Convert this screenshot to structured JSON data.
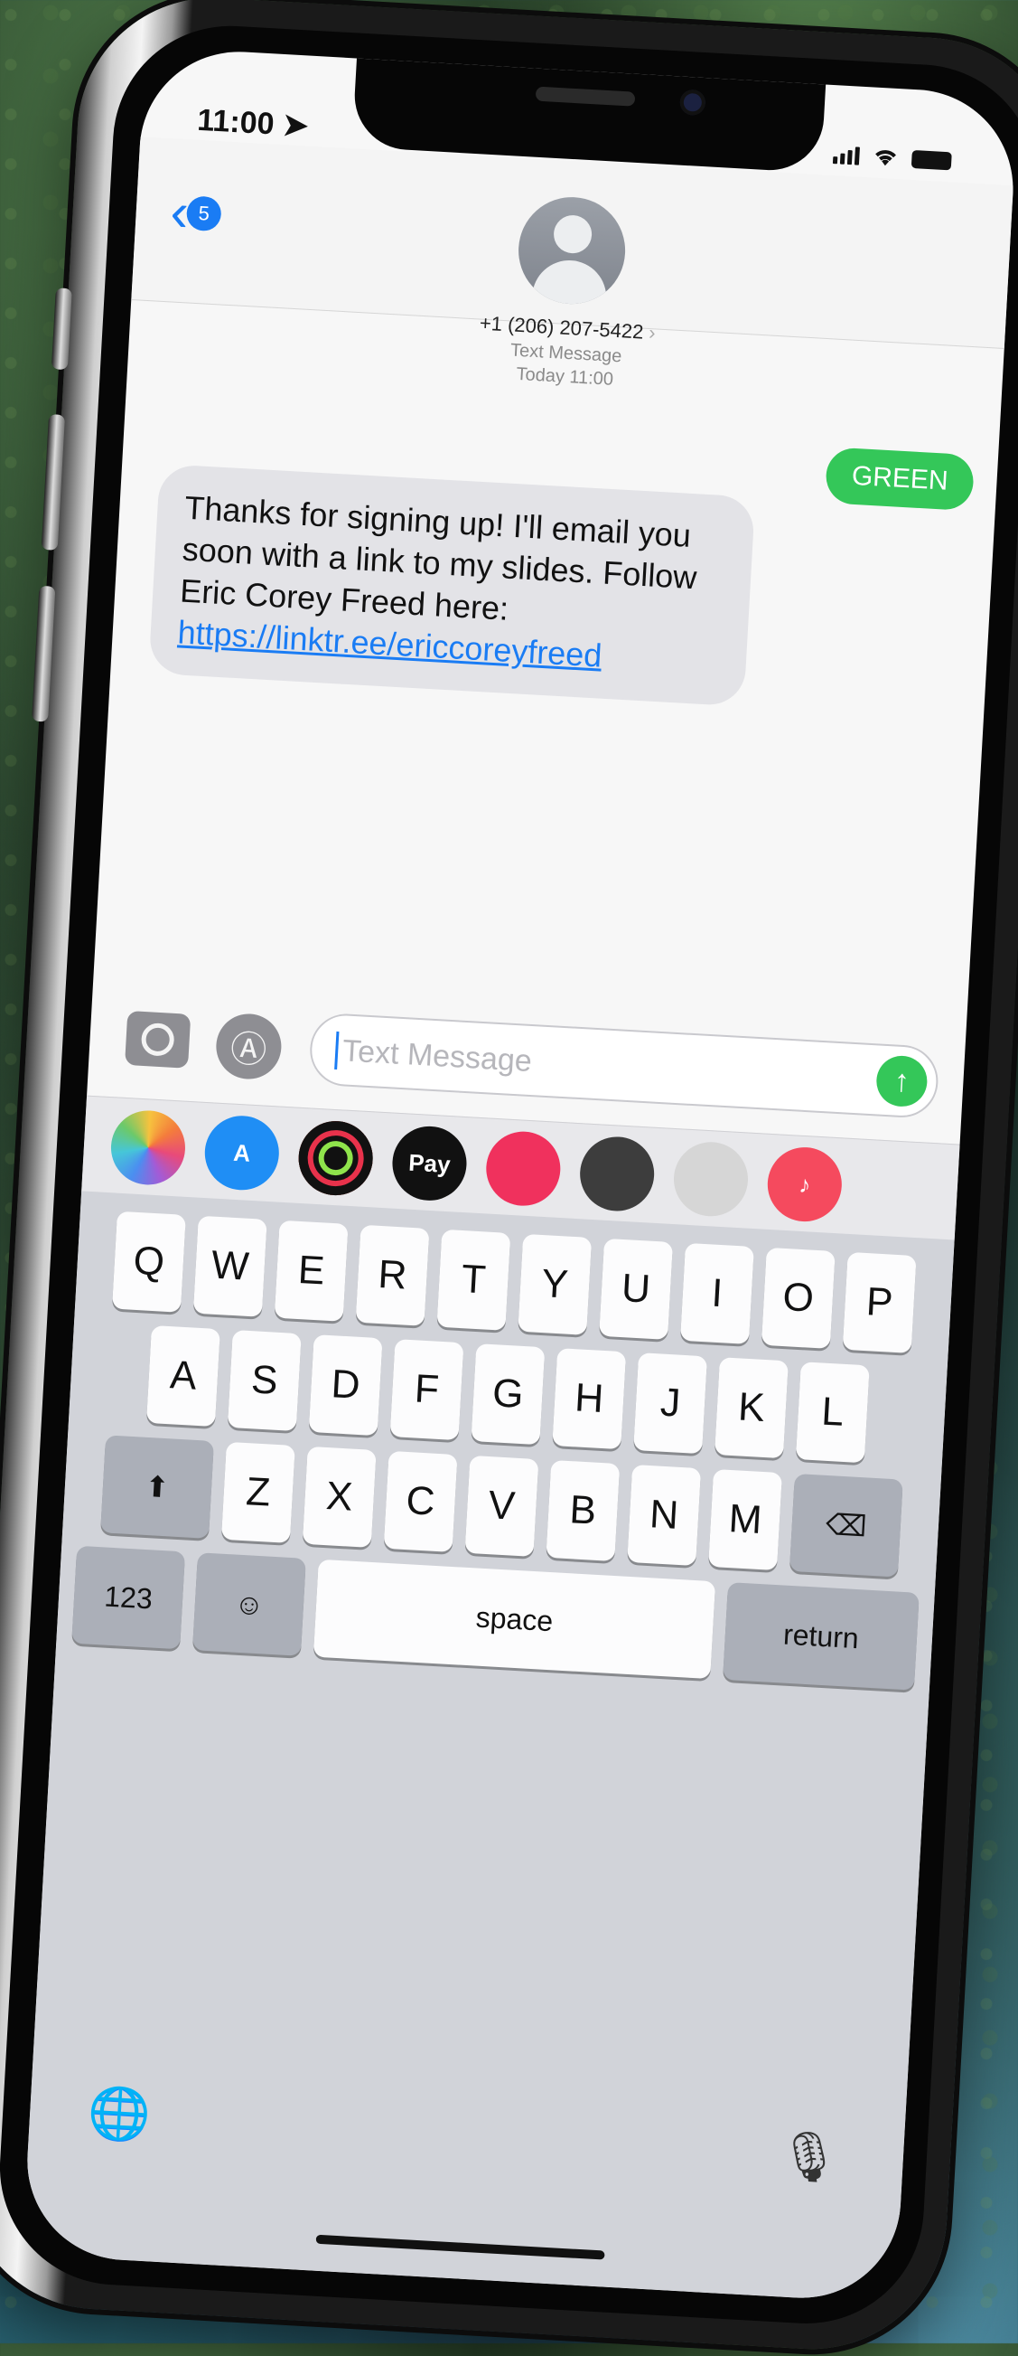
{
  "status_bar": {
    "time": "11:00"
  },
  "conversation": {
    "back_count": "5",
    "contact_number": "+1 (206) 207-5422",
    "contact_chevron": "›",
    "meta_line1": "Text Message",
    "meta_line2": "Today 11:00"
  },
  "messages": {
    "sent": "GREEN",
    "received_text": "Thanks for signing up! I'll email you soon with a link to my slides. Follow Eric Corey Freed here:",
    "received_link": "https://linktr.ee/ericcoreyfreed"
  },
  "input": {
    "placeholder": "Text Message",
    "send_glyph": "↑"
  },
  "app_strip": [
    {
      "name": "photos-app-icon",
      "label": "",
      "color": "#ffffff"
    },
    {
      "name": "app-store-app-icon",
      "label": "A",
      "color": "#1f8ef5"
    },
    {
      "name": "activity-app-icon",
      "label": "",
      "color": "#111111"
    },
    {
      "name": "apple-pay-app-icon",
      "label": "Pay",
      "color": "#111111"
    },
    {
      "name": "search-images-app-icon",
      "label": "",
      "color": "#f0315d"
    },
    {
      "name": "memoji-app-icon",
      "label": "",
      "color": "#3d3d3d"
    },
    {
      "name": "animoji-app-icon",
      "label": "",
      "color": "#d6d6d6"
    },
    {
      "name": "music-app-icon",
      "label": "♪",
      "color": "#f54a5e"
    }
  ],
  "keyboard": {
    "row1": [
      "Q",
      "W",
      "E",
      "R",
      "T",
      "Y",
      "U",
      "I",
      "O",
      "P"
    ],
    "row2": [
      "A",
      "S",
      "D",
      "F",
      "G",
      "H",
      "J",
      "K",
      "L"
    ],
    "row3": [
      "Z",
      "X",
      "C",
      "V",
      "B",
      "N",
      "M"
    ],
    "shift": "⬆",
    "delete": "⌫",
    "numbers": "123",
    "emoji": "☺",
    "space": "space",
    "return": "return",
    "globe": "🌐",
    "mic": "🎙"
  },
  "colors": {
    "accent": "#1a7cf4",
    "sent_bubble": "#34c759",
    "received_bubble": "#e3e3e7"
  }
}
